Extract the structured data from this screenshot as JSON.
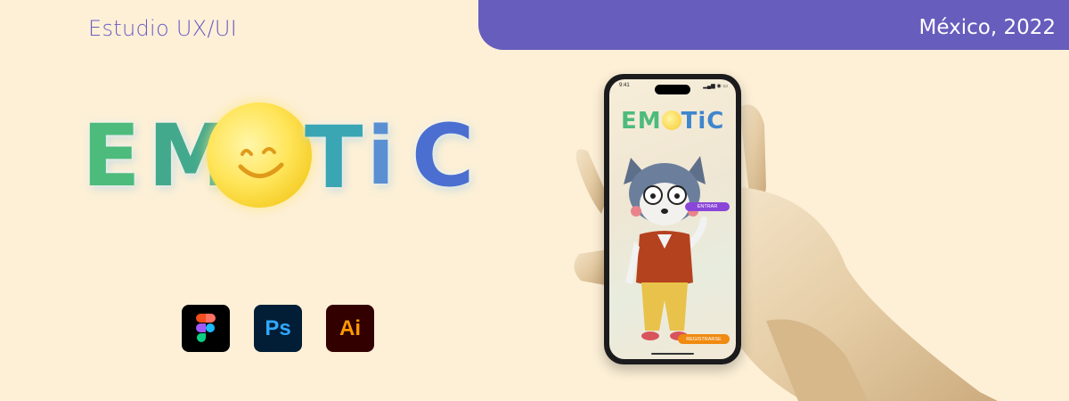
{
  "header": {
    "studio_label": "Estudio UX/UI",
    "place_date": "México, 2022"
  },
  "logo": {
    "letters": [
      "E",
      "M",
      "T",
      "i",
      "C"
    ]
  },
  "tools": [
    {
      "name": "figma",
      "label": ""
    },
    {
      "name": "photoshop",
      "label": "Ps"
    },
    {
      "name": "illustrator",
      "label": "Ai"
    }
  ],
  "phone": {
    "status_time": "9:41",
    "status_icons": "▂▄▆ ◉ ▭",
    "app_name_a": "EM",
    "app_name_b": "TiC",
    "enter_button": "ENTRAR",
    "register_button": "REGISTRARSE"
  },
  "colors": {
    "background": "#fdf0d7",
    "accent": "#675dbd",
    "enter": "#8a46d8",
    "register": "#f08a10"
  }
}
